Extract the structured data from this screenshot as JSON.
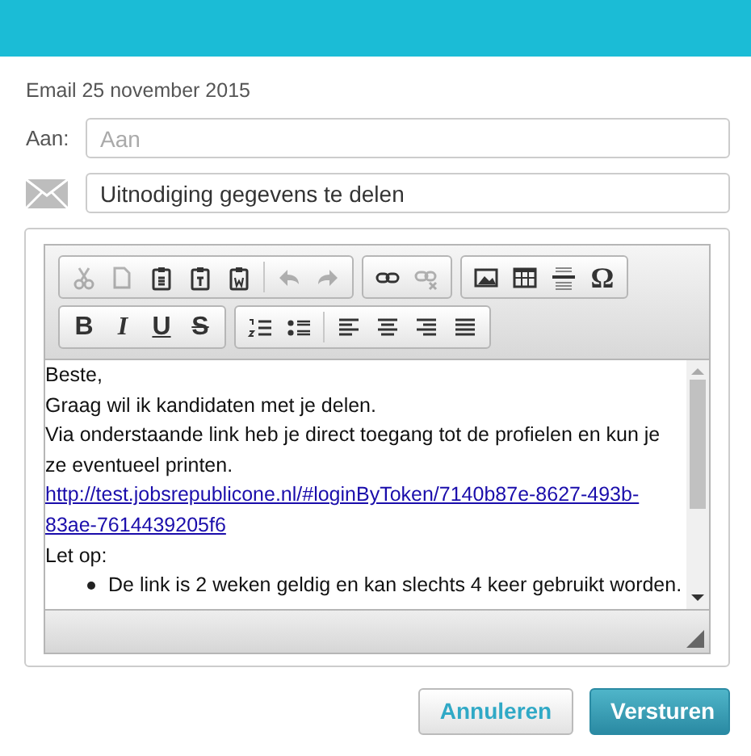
{
  "title": "Email 25 november 2015",
  "to": {
    "label": "Aan:",
    "placeholder": "Aan"
  },
  "subject": {
    "value": "Uitnodiging gegevens te delen"
  },
  "editor": {
    "toolbar": [
      [
        [
          {
            "kind": "icon",
            "disabled": true
          },
          {
            "kind": "icon",
            "disabled": true
          },
          {
            "kind": "icon",
            "disabled": false
          },
          {
            "kind": "icon",
            "disabled": false
          },
          {
            "kind": "icon",
            "disabled": false
          },
          {
            "kind": "separator"
          },
          {
            "kind": "icon",
            "disabled": true
          },
          {
            "kind": "icon",
            "disabled": true
          }
        ],
        [
          {
            "kind": "icon",
            "disabled": false
          },
          {
            "kind": "icon",
            "disabled": true
          }
        ],
        [
          {
            "kind": "icon",
            "disabled": false
          },
          {
            "kind": "icon",
            "disabled": false
          },
          {
            "kind": "icon",
            "disabled": false
          },
          {
            "kind": "glyph",
            "text": "Ω",
            "disabled": false
          }
        ]
      ],
      [
        [
          {
            "kind": "glyph",
            "text": "B",
            "disabled": false
          },
          {
            "kind": "glyph",
            "text": "I",
            "disabled": false
          },
          {
            "kind": "glyph",
            "text": "U",
            "disabled": false
          },
          {
            "kind": "glyph",
            "text": "S",
            "disabled": false
          }
        ],
        [
          {
            "kind": "icon",
            "disabled": false
          },
          {
            "kind": "icon",
            "disabled": false
          },
          {
            "kind": "separator"
          },
          {
            "kind": "icon",
            "disabled": false
          },
          {
            "kind": "icon",
            "disabled": false
          },
          {
            "kind": "icon",
            "disabled": false
          },
          {
            "kind": "icon",
            "disabled": false
          }
        ]
      ]
    ],
    "body": [
      {
        "kind": "text",
        "text": "Beste,"
      },
      {
        "kind": "text",
        "text": "Graag wil ik kandidaten met je delen."
      },
      {
        "kind": "text",
        "text": "Via onderstaande link heb je direct toegang tot de profielen en kun je ze eventueel printen."
      },
      {
        "kind": "link",
        "text": "http://test.jobsrepublicone.nl/#loginByToken/7140b87e-8627-493b-83ae-7614439205f6"
      },
      {
        "kind": "text",
        "text": "Let op:"
      },
      {
        "kind": "bullet",
        "text": "De link is 2 weken geldig en kan slechts 4 keer gebruikt worden."
      }
    ]
  },
  "buttons": [
    {
      "label": "Annuleren",
      "kind": "secondary"
    },
    {
      "label": "Versturen",
      "kind": "primary"
    }
  ]
}
